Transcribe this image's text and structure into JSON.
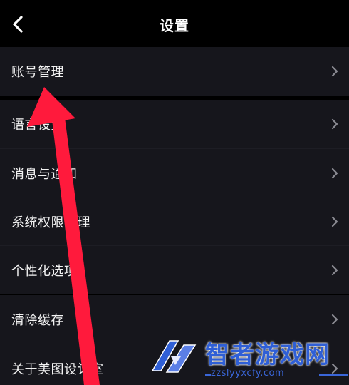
{
  "header": {
    "title": "设置",
    "back_icon": "chevron-left-icon"
  },
  "sections": [
    {
      "items": [
        {
          "label": "账号管理",
          "icon": "chevron-right-icon"
        }
      ]
    },
    {
      "items": [
        {
          "label": "语言设置",
          "icon": "chevron-right-icon"
        },
        {
          "label": "消息与通知",
          "icon": "chevron-right-icon"
        },
        {
          "label": "系统权限管理",
          "icon": "chevron-right-icon"
        },
        {
          "label": "个性化选项",
          "icon": "chevron-right-icon"
        }
      ]
    },
    {
      "items": [
        {
          "label": "清除缓存",
          "icon": "chevron-right-icon"
        },
        {
          "label": "关于美图设计室",
          "icon": "chevron-right-icon"
        }
      ]
    }
  ],
  "annotation": {
    "arrow_color": "#ff1a3c",
    "points_to": "账号管理"
  },
  "watermark": {
    "title": "智者游戏网",
    "url": "zzslyyxcfy.com",
    "color": "#2f5fd6"
  },
  "colors": {
    "background": "#000000",
    "section_background": "#16161c",
    "text": "#f2f2f2",
    "chevron": "#8a8a92"
  }
}
